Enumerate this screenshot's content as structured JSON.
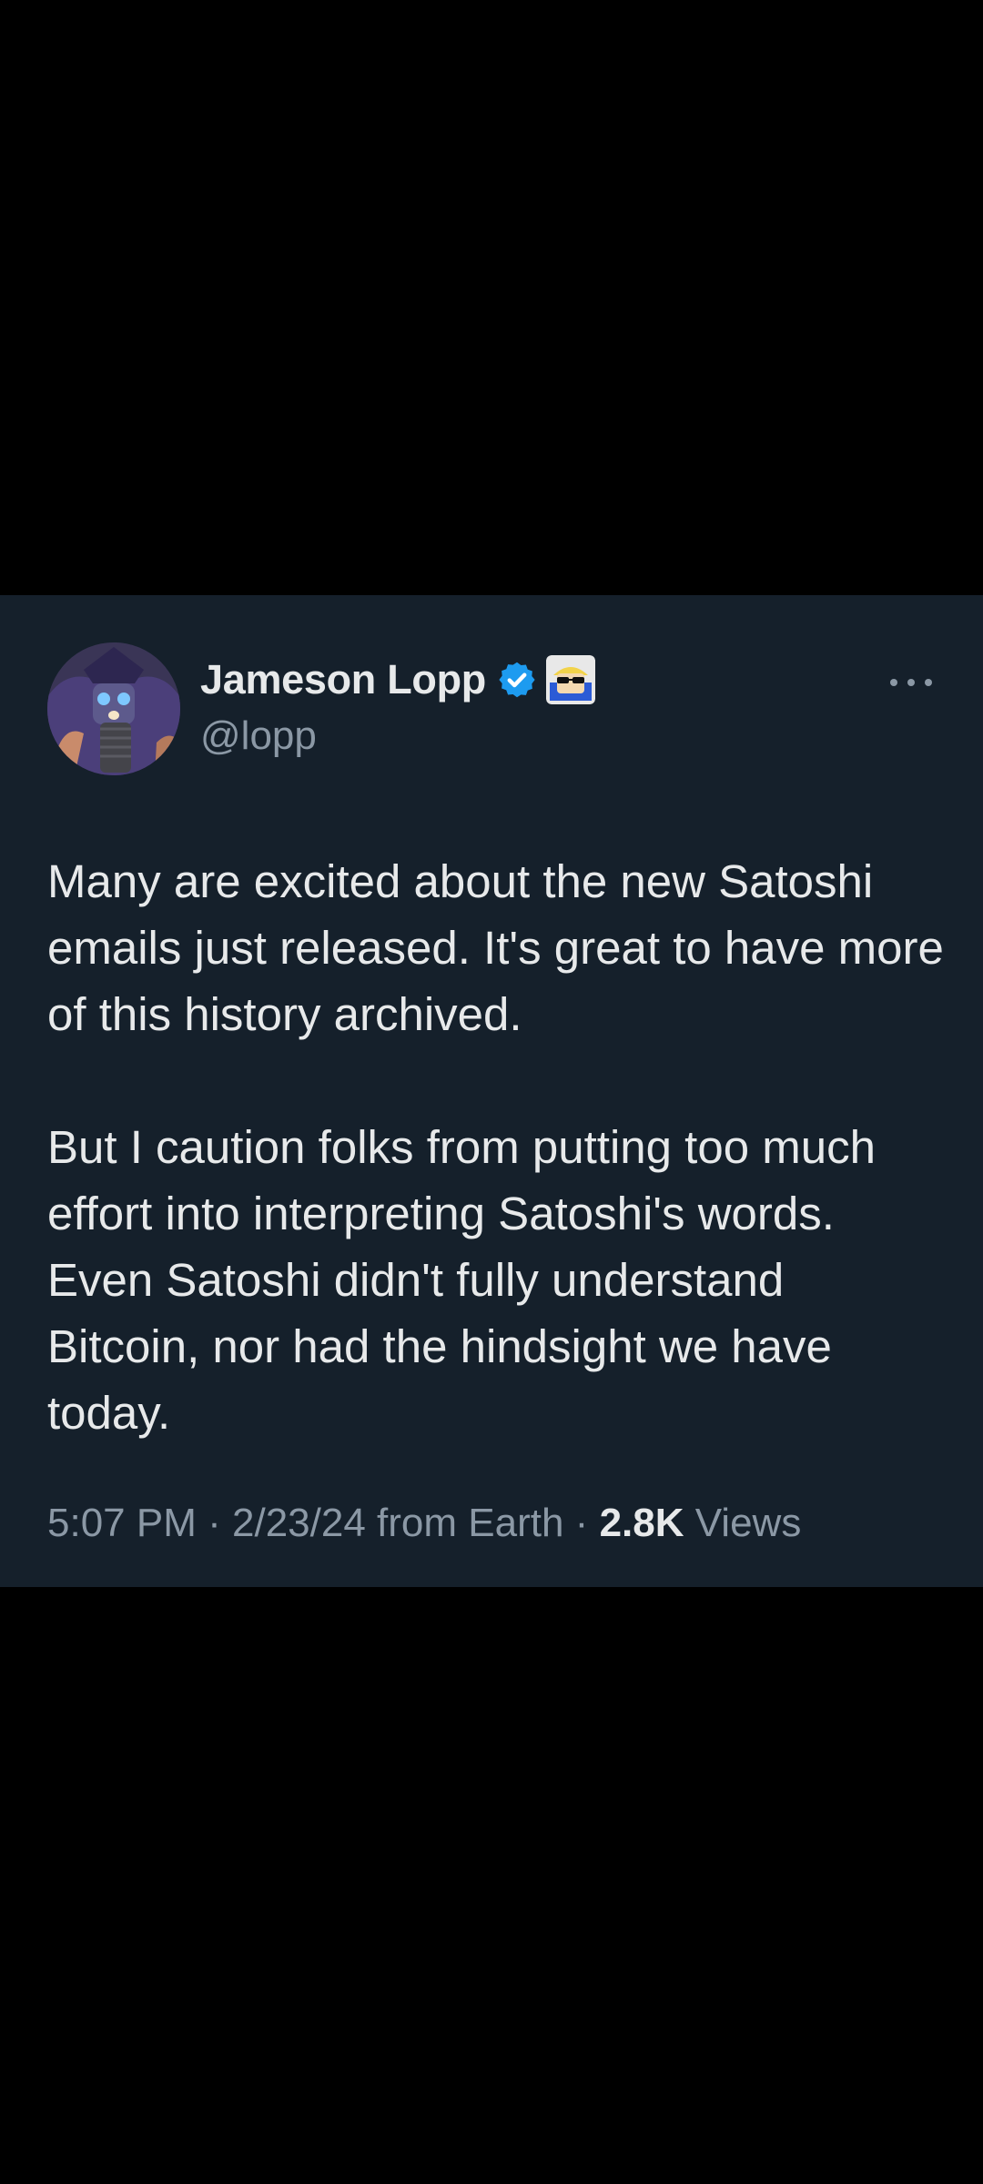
{
  "tweet": {
    "author": {
      "display_name": "Jameson Lopp",
      "handle": "@lopp",
      "avatar_icon": "wizard-avatar-icon",
      "verified_icon": "verified-check-icon",
      "affiliate_icon": "sunglasses-emoji-badge-icon"
    },
    "more_icon": "more-options-icon",
    "paragraphs": [
      "Many are excited about the new Satoshi emails just released. It's great to have more of this history archived.",
      "But I caution folks from putting too much effort into interpreting Satoshi's words. Even Satoshi didn't fully understand Bitcoin, nor had the hindsight we have today."
    ],
    "meta": {
      "time": "5:07 PM",
      "separator": "·",
      "date": "2/23/24",
      "source": "from Earth",
      "views_count": "2.8K",
      "views_label": "Views"
    }
  },
  "colors": {
    "page_background": "#000000",
    "card_background": "#15202b",
    "primary_text": "#e7e9ea",
    "secondary_text": "#8b98a5",
    "verified_blue": "#1d9bf0"
  }
}
